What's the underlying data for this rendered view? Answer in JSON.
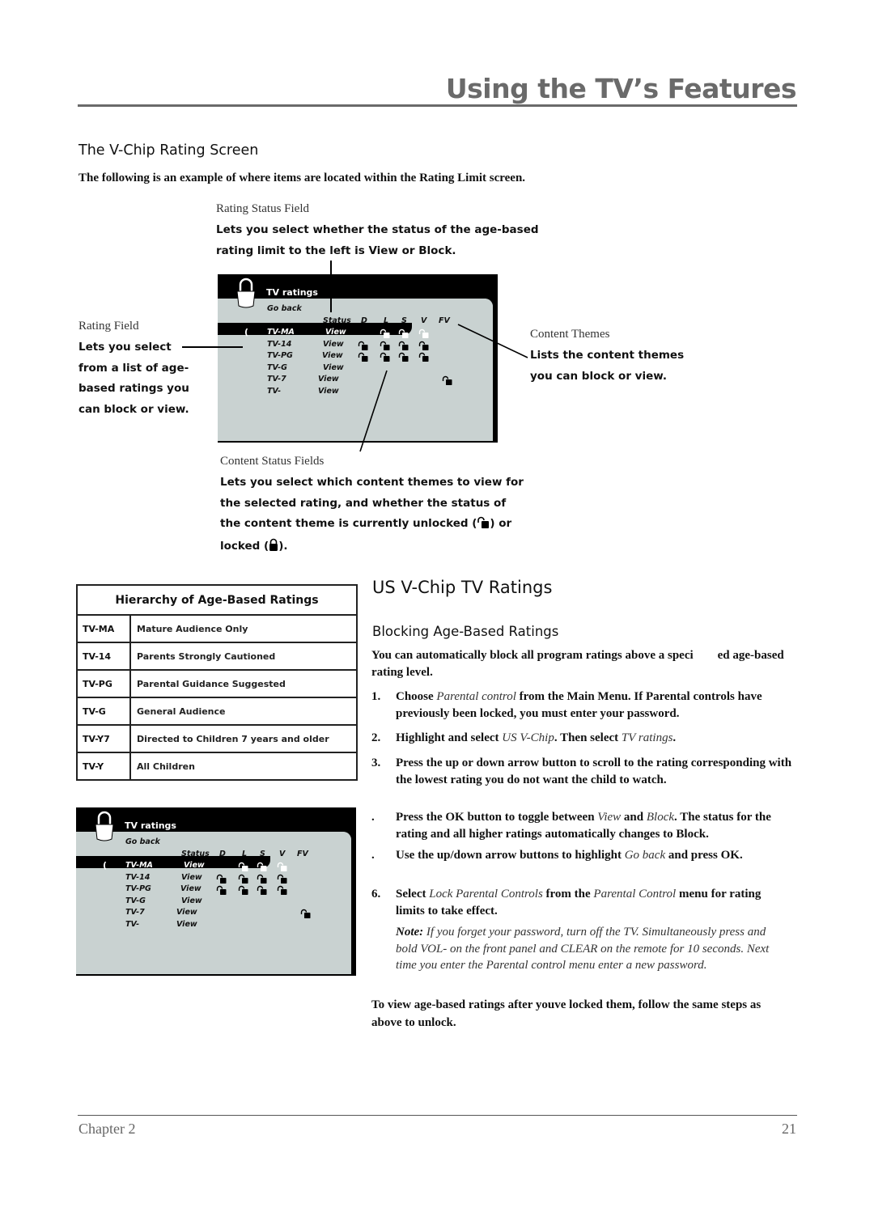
{
  "header": {
    "title": "Using the TV’s Features"
  },
  "vchip_section": {
    "heading": "The V-Chip Rating Screen",
    "intro": "The following is an example of where items are located within the Rating Limit screen.",
    "callouts": {
      "rating_status": {
        "label": "Rating Status Field",
        "text_lines": [
          "Lets you select whether the status of the age-based",
          "rating limit to the left is View or Block."
        ]
      },
      "rating_field": {
        "label": "Rating Field",
        "text_lines": [
          "Lets you select",
          "from a list of age-",
          "based ratings you",
          "can block or view."
        ]
      },
      "content_themes": {
        "label": "Content Themes",
        "text_lines": [
          "Lists the content themes",
          "you can block or view."
        ]
      },
      "content_status": {
        "label": "Content Status Fields",
        "text_lines": [
          "Lets you select which content themes to view for",
          "the selected rating, and whether the status of",
          "the content theme is currently unlocked (",
          ") or",
          "locked (",
          ")."
        ]
      }
    }
  },
  "tv_screen": {
    "title": "TV ratings",
    "go_back": "Go back",
    "status_header": "Status",
    "theme_headers": [
      "D",
      "L",
      "S",
      "V",
      "FV"
    ],
    "cursor": "(",
    "rows": [
      {
        "rating": "TV-MA",
        "status": "View",
        "locks": [
          null,
          "open-white",
          "open-white",
          "open-white",
          null
        ],
        "selected": true
      },
      {
        "rating": "TV-14",
        "status": "View",
        "locks": [
          "open",
          "open",
          "open",
          "open",
          null
        ],
        "selected": false
      },
      {
        "rating": "TV-PG",
        "status": "View",
        "locks": [
          "open",
          "open",
          "open",
          "open",
          null
        ],
        "selected": false
      },
      {
        "rating": "TV-G",
        "status": "View",
        "locks": [
          null,
          null,
          null,
          null,
          null
        ],
        "selected": false
      },
      {
        "rating": "TV-7",
        "status": "View",
        "locks": [
          null,
          null,
          null,
          null,
          "open"
        ],
        "selected": false
      },
      {
        "rating": "TV-",
        "status": "View",
        "locks": [
          null,
          null,
          null,
          null,
          null
        ],
        "selected": false
      }
    ]
  },
  "hierarchy_table": {
    "title": "Hierarchy of Age-Based Ratings",
    "rows": [
      {
        "code": "TV-MA",
        "desc": "Mature Audience Only"
      },
      {
        "code": "TV-14",
        "desc": "Parents Strongly Cautioned"
      },
      {
        "code": "TV-PG",
        "desc": "Parental Guidance Suggested"
      },
      {
        "code": "TV-G",
        "desc": "General Audience"
      },
      {
        "code": "TV-Y7",
        "desc": "Directed to Children 7 years and older"
      },
      {
        "code": "TV-Y",
        "desc": "All Children"
      }
    ]
  },
  "us_vchip": {
    "heading": "US V-Chip TV Ratings",
    "subheading": "Blocking Age-Based Ratings",
    "intro": "You can automatically block all program ratings above a speci  ed age-based rating level.",
    "steps": [
      {
        "num": "1.",
        "parts": [
          "Choose ",
          "Parental control",
          " from the Main Menu. If Parental controls have previously been locked, you must enter your password."
        ]
      },
      {
        "num": "2.",
        "parts": [
          "Highlight and select ",
          "US V-Chip",
          ". Then select ",
          "TV ratings",
          "."
        ]
      },
      {
        "num": "3.",
        "parts": [
          "Press the up or down arrow button to scroll to the rating corresponding with the lowest rating you do not want the child to watch."
        ]
      },
      {
        "num": ".",
        "parts": [
          "Press the OK button to toggle between ",
          "View",
          " and ",
          "Block",
          ". The status for the rating and all higher ratings automatically changes to Block."
        ]
      },
      {
        "num": ".",
        "parts": [
          "Use the up/down arrow buttons to highlight ",
          "Go back",
          " and press OK."
        ]
      },
      {
        "num": "6.",
        "parts": [
          "Select ",
          "Lock Parental Controls",
          " from the ",
          "Parental Control",
          " menu for rating limits to take effect."
        ]
      }
    ],
    "note_label": "Note:",
    "note_text": " If you forget your password, turn off the TV. Simultaneously press and bold VOL- on the front panel and CLEAR on the remote for 10 seconds. Next time you enter the Parental control menu enter a new password.",
    "closing": "To view age-based ratings after youve locked them, follow the same steps as above to unlock."
  },
  "footer": {
    "chapter": "Chapter 2",
    "page": "21"
  }
}
